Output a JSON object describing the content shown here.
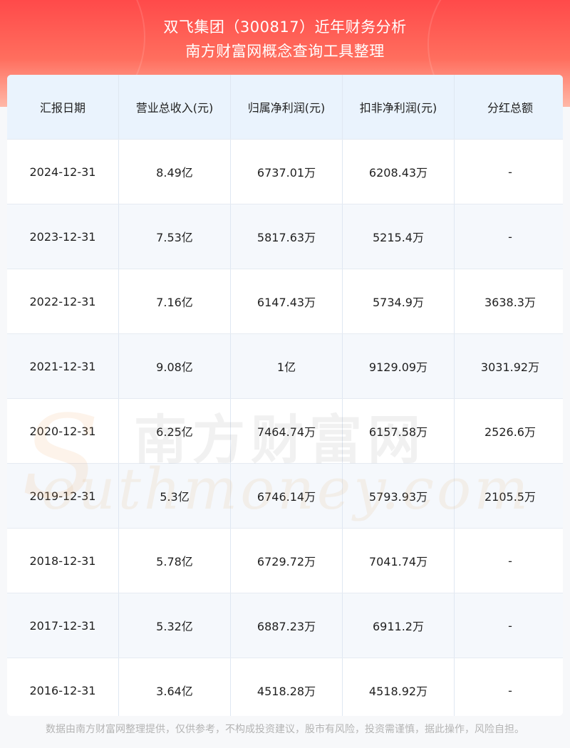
{
  "header": {
    "title": "双飞集团（300817）近年财务分析",
    "subtitle": "南方财富网概念查询工具整理"
  },
  "table": {
    "columns": [
      "汇报日期",
      "营业总收入(元)",
      "归属净利润(元)",
      "扣非净利润(元)",
      "分红总额"
    ],
    "rows": [
      [
        "2024-12-31",
        "8.49亿",
        "6737.01万",
        "6208.43万",
        "-"
      ],
      [
        "2023-12-31",
        "7.53亿",
        "5817.63万",
        "5215.4万",
        "-"
      ],
      [
        "2022-12-31",
        "7.16亿",
        "6147.43万",
        "5734.9万",
        "3638.3万"
      ],
      [
        "2021-12-31",
        "9.08亿",
        "1亿",
        "9129.09万",
        "3031.92万"
      ],
      [
        "2020-12-31",
        "6.25亿",
        "7464.74万",
        "6157.58万",
        "2526.6万"
      ],
      [
        "2019-12-31",
        "5.3亿",
        "6746.14万",
        "5793.93万",
        "2105.5万"
      ],
      [
        "2018-12-31",
        "5.78亿",
        "6729.72万",
        "7041.74万",
        "-"
      ],
      [
        "2017-12-31",
        "5.32亿",
        "6887.23万",
        "6911.2万",
        "-"
      ],
      [
        "2016-12-31",
        "3.64亿",
        "4518.28万",
        "4518.92万",
        "-"
      ]
    ]
  },
  "watermark": {
    "cn": "南方财富网",
    "en": "outhmoney.com",
    "s": "S"
  },
  "footer": {
    "disclaimer": "数据由南方财富网整理提供，仅供参考，不构成投资建议，股市有风险，投资需谨慎，据此操作，风险自担。"
  },
  "colors": {
    "header_red": "#ff4a4a",
    "header_head_bg": "#eaf3fd",
    "row_alt_bg": "#f5f8fc"
  }
}
